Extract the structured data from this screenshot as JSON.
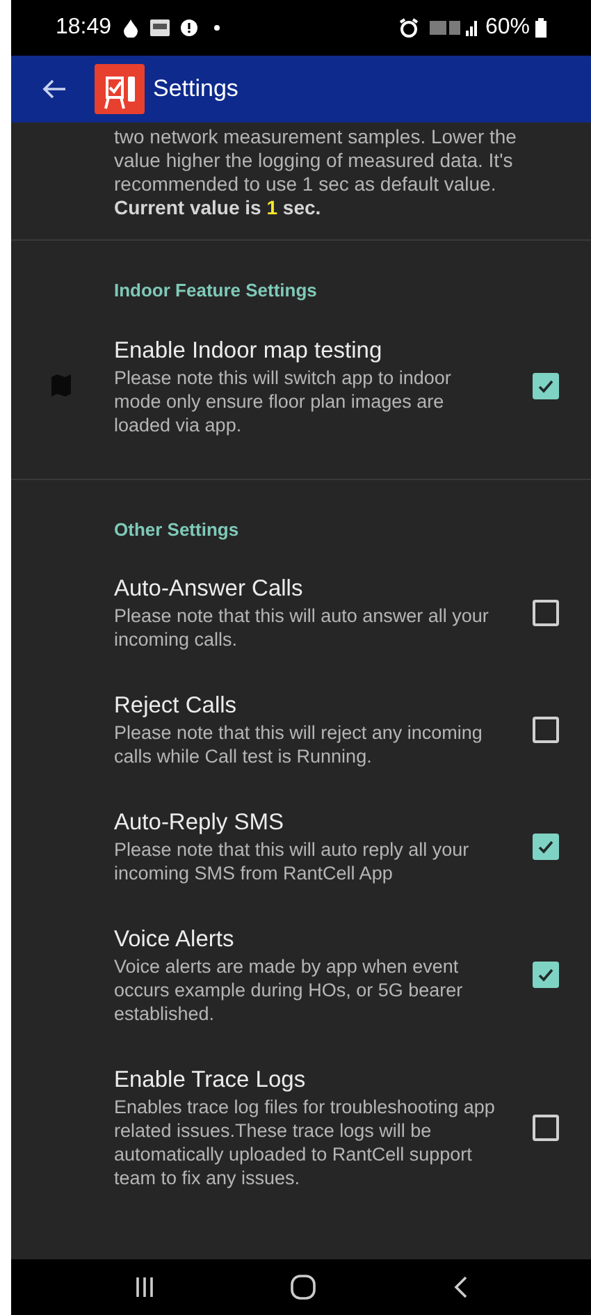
{
  "status_bar": {
    "time": "18:49",
    "battery": "60%"
  },
  "app_bar": {
    "title": "Settings"
  },
  "intro": {
    "lines": [
      "two network measurement samples. Lower the",
      "value higher the logging of measured data. It's",
      "recommended to use 1 sec as default value."
    ],
    "current": "**Current value is** 1 **sec.**"
  },
  "sections": [
    {
      "header": "Indoor Feature Settings",
      "items": [
        {
          "title": "Enable Indoor map testing",
          "summary": "Please note this will switch app to indoor mode only ensure floor plan images are loaded via app.",
          "checked": true
        }
      ]
    },
    {
      "header": "Other Settings",
      "items": [
        {
          "title": "Auto-Answer Calls",
          "summary": "Please note that this will auto answer all your incoming calls.",
          "checked": false
        },
        {
          "title": "Reject Calls",
          "summary": "Please note that this will reject any incoming calls while Call test is Running.",
          "checked": false
        },
        {
          "title": "Auto-Reply SMS",
          "summary": "Please note that this will auto reply all your incoming SMS from RantCell App",
          "checked": true
        },
        {
          "title": "Voice Alerts",
          "summary": "Voice alerts are made by app when event occurs example during HOs, or 5G bearer established.",
          "checked": true
        },
        {
          "title": "Enable Trace Logs",
          "summary": "Enables trace log files for troubleshooting app related issues.These trace logs will be automatically uploaded to RantCell support team to fix any issues.",
          "checked": false
        }
      ]
    }
  ]
}
